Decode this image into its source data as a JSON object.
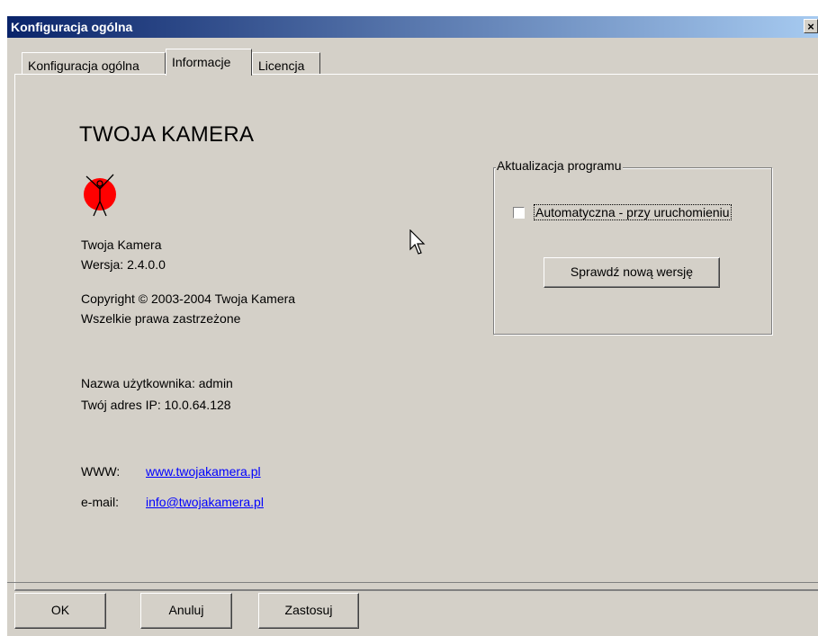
{
  "window": {
    "title": "Konfiguracja ogólna",
    "close_glyph": "×"
  },
  "tabs": [
    {
      "label": "Konfiguracja ogólna",
      "active": false
    },
    {
      "label": "Informacje",
      "active": true
    },
    {
      "label": "Licencja",
      "active": false
    }
  ],
  "info": {
    "app_title": "TWOJA KAMERA",
    "logo_icon": "stick-figure-red-circle-icon",
    "product_name": "Twoja Kamera",
    "version": "Wersja: 2.4.0.0",
    "copyright": "Copyright © 2003-2004 Twoja Kamera",
    "rights": "Wszelkie prawa zastrzeżone",
    "username": "Nazwa użytkownika: admin",
    "ip": "Twój adres IP: 10.0.64.128",
    "www_label": "WWW:",
    "www_link": "www.twojakamera.pl",
    "email_label": "e-mail:",
    "email_link": "info@twojakamera.pl"
  },
  "update": {
    "group_title": "Aktualizacja programu",
    "auto_label": "Automatyczna - przy uruchomieniu",
    "auto_checked": false,
    "check_button": "Sprawdź nową wersję"
  },
  "buttons": {
    "ok": "OK",
    "cancel": "Anuluj",
    "apply": "Zastosuj"
  },
  "colors": {
    "title_gradient_start": "#0a246a",
    "title_gradient_end": "#a6caf0",
    "face": "#d4d0c8",
    "link": "#0000ff",
    "logo_red": "#ff0000"
  }
}
